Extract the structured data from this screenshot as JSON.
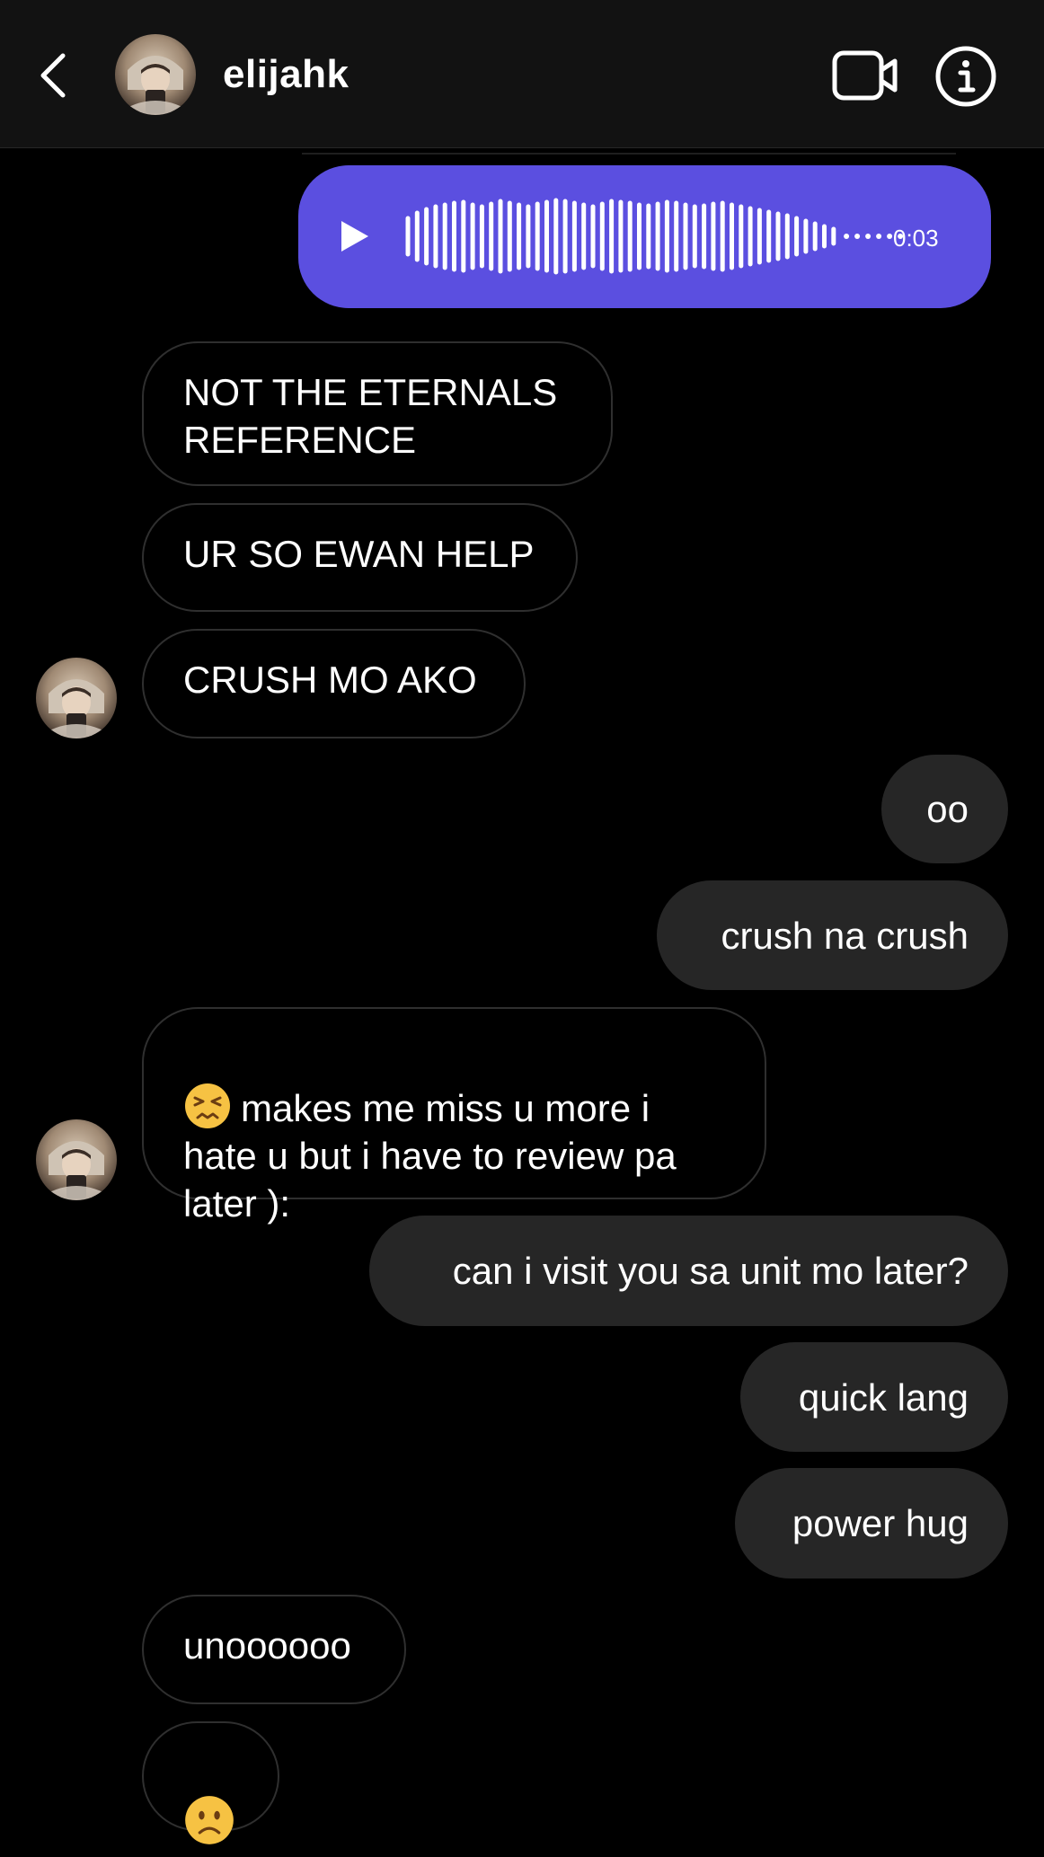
{
  "header": {
    "username": "elijahk"
  },
  "voice_message": {
    "duration": "0:03"
  },
  "messages": [
    {
      "side": "in",
      "text": "NOT THE ETERNALS\nREFERENCE"
    },
    {
      "side": "in",
      "text": "UR SO EWAN HELP"
    },
    {
      "side": "in",
      "text": "CRUSH MO AKO"
    },
    {
      "side": "out",
      "text": "oo"
    },
    {
      "side": "out",
      "text": "crush na crush"
    },
    {
      "side": "in",
      "text": "makes me miss u more i\nhate u but i have to review pa\nlater ):",
      "emoji": "persevering-face-emoji"
    },
    {
      "side": "out",
      "text": "can i visit you sa unit mo later?"
    },
    {
      "side": "out",
      "text": "quick lang"
    },
    {
      "side": "out",
      "text": "power hug"
    },
    {
      "side": "in",
      "text": "unoooooo"
    },
    {
      "side": "in",
      "emoji": "frowning-face-emoji"
    }
  ],
  "colors": {
    "background": "#000000",
    "header": "#121212",
    "voice_bubble": "#5b4fe0",
    "outgoing_bubble": "#262626",
    "incoming_border": "#2f2f2f"
  },
  "icons": [
    "back-chevron-icon",
    "video-call-icon",
    "info-icon",
    "play-icon"
  ]
}
